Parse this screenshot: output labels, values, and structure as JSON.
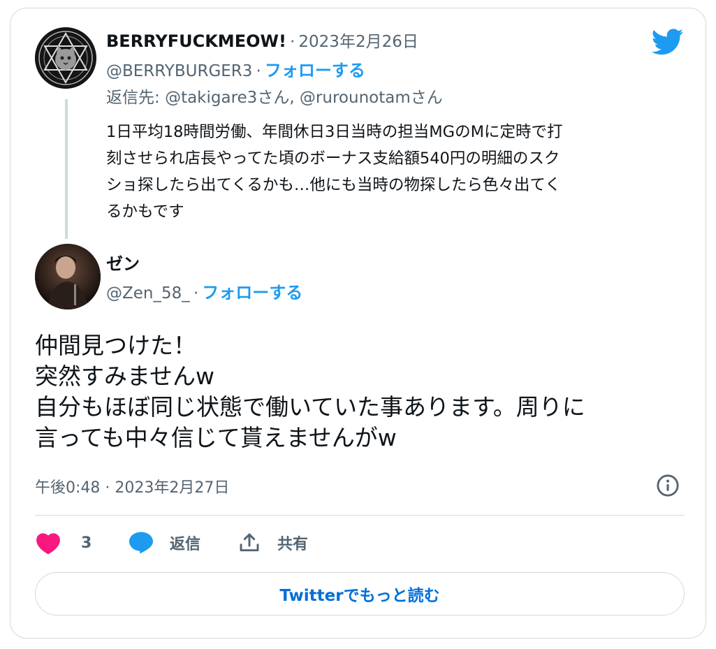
{
  "quoted_tweet": {
    "display_name": "BERRYFUCKMEOW!",
    "date": "2023年2月26日",
    "handle": "@BERRYBURGER3",
    "follow_label": "フォローする",
    "reply_to_prefix": "返信先: ",
    "reply_to": "@takigare3さん, @rurounotamさん",
    "text_lines": [
      "1日平均18時間労働、年間休日3日当時の担当MGのMに定時で打",
      "刻させられ店長やってた頃のボーナス支給額540円の明細のスク",
      "ショ探したら出てくるかも…他にも当時の物探したら色々出てく",
      "るかもです"
    ]
  },
  "main_tweet": {
    "display_name": "ゼン",
    "handle": "@Zen_58_",
    "follow_label": "フォローする",
    "text_lines": [
      "仲間見つけた！",
      "突然すみませんw",
      "自分もほぼ同じ状態で働いていた事あります。周りに",
      "言っても中々信じて貰えませんがw"
    ],
    "timestamp": "午後0:48 · 2023年2月27日"
  },
  "separator": "·",
  "actions": {
    "like_count": "3",
    "reply_label": "返信",
    "share_label": "共有"
  },
  "read_more_label": "Twitterでもっと読む",
  "icons": [
    "twitter-bird-icon",
    "info-icon",
    "heart-icon",
    "reply-bubble-icon",
    "share-icon"
  ],
  "colors": {
    "accent": "#1d9bf0",
    "like": "#f91880",
    "muted": "#536471",
    "border": "#cfd9de"
  }
}
